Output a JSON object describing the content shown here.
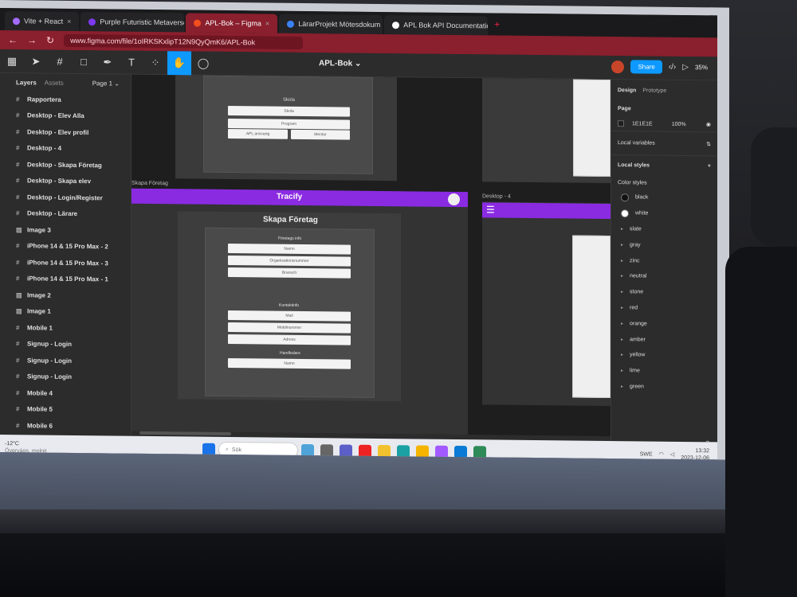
{
  "browser": {
    "tabs": [
      {
        "label": "Vite + React",
        "color": "#a46bff"
      },
      {
        "label": "Purple Futuristic Metaverse",
        "color": "#7c3aed"
      },
      {
        "label": "APL-Bok – Figma",
        "color": "#f24e1e",
        "active": true
      },
      {
        "label": "LärarProjekt Mötesdokum",
        "color": "#3b82f6"
      },
      {
        "label": "APL Bok API Documentation",
        "color": "#ffffff"
      }
    ],
    "url": "www.figma.com/file/1oIRKSKxlipT12N9QyQmK6/APL-Bok"
  },
  "figma": {
    "file_title": "APL-Bok ⌄",
    "share_label": "Share",
    "zoom": "35%",
    "layers_tab": "Layers",
    "assets_tab": "Assets",
    "page_selector": "Page 1 ⌄",
    "layers": [
      {
        "label": "Rapportera",
        "icon": "frame"
      },
      {
        "label": "Desktop - Elev Alla",
        "icon": "frame"
      },
      {
        "label": "Desktop - Elev profil",
        "icon": "frame"
      },
      {
        "label": "Desktop - 4",
        "icon": "frame"
      },
      {
        "label": "Desktop - Skapa Företag",
        "icon": "frame"
      },
      {
        "label": "Desktop - Skapa elev",
        "icon": "frame"
      },
      {
        "label": "Desktop - Login/Register",
        "icon": "frame"
      },
      {
        "label": "Desktop - Lärare",
        "icon": "frame"
      },
      {
        "label": "Image 3",
        "icon": "image"
      },
      {
        "label": "iPhone 14 & 15 Pro Max - 2",
        "icon": "frame"
      },
      {
        "label": "iPhone 14 & 15 Pro Max - 3",
        "icon": "frame"
      },
      {
        "label": "iPhone 14 & 15 Pro Max - 1",
        "icon": "frame"
      },
      {
        "label": "Image 2",
        "icon": "image"
      },
      {
        "label": "Image 1",
        "icon": "image"
      },
      {
        "label": "Mobile 1",
        "icon": "frame"
      },
      {
        "label": "Signup - Login",
        "icon": "frame"
      },
      {
        "label": "Signup - Login",
        "icon": "frame"
      },
      {
        "label": "Signup - Login",
        "icon": "frame"
      },
      {
        "label": "Mobile 4",
        "icon": "frame"
      },
      {
        "label": "Mobile 5",
        "icon": "frame"
      },
      {
        "label": "Mobile 6",
        "icon": "frame"
      }
    ],
    "canvas": {
      "top_frame_card": {
        "heading": "Skola",
        "fields": [
          "Skola",
          "Program"
        ],
        "buttons": [
          "APL ansvarig",
          "Mentor"
        ]
      },
      "main_frame_label": "Skapa Företag",
      "header_title": "Tracify",
      "page_heading": "Skapa Företag",
      "company_section": "Företags info",
      "company_fields": [
        "Namn",
        "Organisationsnummer",
        "Bransch"
      ],
      "contact_section": "Kontaktinfo",
      "contact_fields": [
        "Mail",
        "Mobilnummer",
        "Adress"
      ],
      "supervisor_section": "Handledare",
      "supervisor_fields": [
        "Namn"
      ],
      "side_frame_label": "Desktop - 4"
    },
    "right_panel": {
      "design_tab": "Design",
      "prototype_tab": "Prototype",
      "page_section": "Page",
      "page_color": "1E1E1E",
      "page_opacity": "100%",
      "local_variables": "Local variables",
      "local_styles": "Local styles",
      "color_styles": "Color styles",
      "colors": [
        {
          "name": "black",
          "swatch": "#111111"
        },
        {
          "name": "white",
          "swatch": "#ffffff"
        },
        {
          "name": "slate"
        },
        {
          "name": "gray"
        },
        {
          "name": "zinc"
        },
        {
          "name": "neutral"
        },
        {
          "name": "stone"
        },
        {
          "name": "red"
        },
        {
          "name": "orange"
        },
        {
          "name": "amber"
        },
        {
          "name": "yellow"
        },
        {
          "name": "lime"
        },
        {
          "name": "green"
        }
      ],
      "help": "?"
    }
  },
  "taskbar": {
    "weather_temp": "-12°C",
    "weather_desc": "Övervägs. molnit",
    "search_placeholder": "Sök",
    "lang": "SWE",
    "time": "13:32",
    "date": "2023-12-06"
  },
  "colors": {
    "accent_purple": "#8a2be2",
    "figma_blue": "#0d99ff",
    "browser_red": "#8a1f2d"
  }
}
